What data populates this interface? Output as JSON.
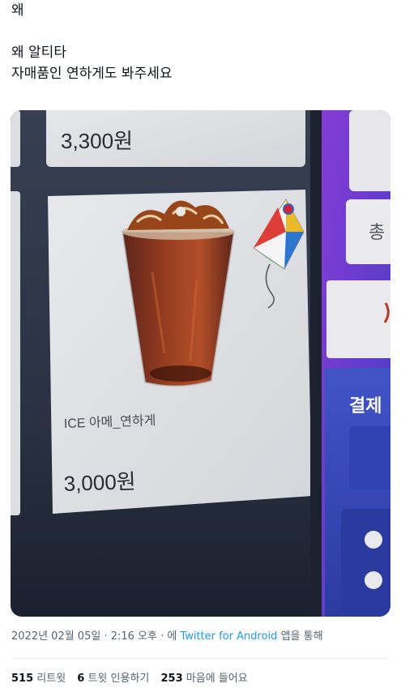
{
  "tweet": {
    "lines": [
      "왜",
      "",
      "왜 알티타",
      "자매품인 연하게도 봐주세요"
    ]
  },
  "photo": {
    "top_card_price": "3,300원",
    "item_name": "ICE 아메_연하게",
    "item_price": "3,000원",
    "side_label_1": "총",
    "side_label_2": "결제",
    "colors": {
      "screen_bg": "#2c3446",
      "card": "#eceef0",
      "panel_purple": "#6a3fd0",
      "panel_blue": "#3f4fc6"
    },
    "icons": [
      "iced-americano-cup-image",
      "korean-kite-logo"
    ]
  },
  "meta": {
    "datetime": "2022년 02월 05일 · 2:16 오후 · 에 ",
    "source": "Twitter for Android",
    "suffix": " 앱을 통해"
  },
  "stats": {
    "retweets_count": "515",
    "retweets_label": " 리트윗",
    "quotes_count": "6",
    "quotes_label": " 트윗 인용하기",
    "likes_count": "253",
    "likes_label": " 마음에 들어요"
  }
}
